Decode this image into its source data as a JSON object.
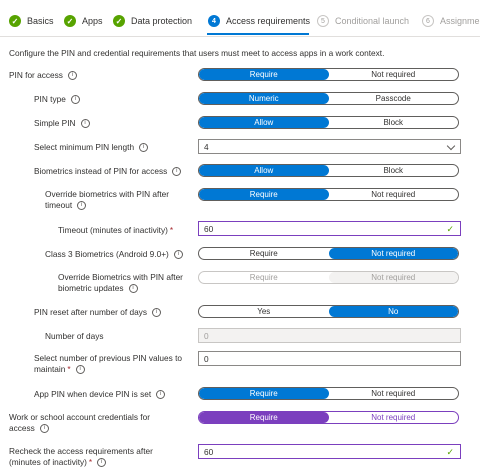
{
  "tabs": [
    {
      "label": "Basics",
      "state": "done",
      "icon": "check"
    },
    {
      "label": "Apps",
      "state": "done",
      "icon": "check"
    },
    {
      "label": "Data protection",
      "state": "done",
      "icon": "check"
    },
    {
      "label": "Access requirements",
      "state": "current",
      "num": "4"
    },
    {
      "label": "Conditional launch",
      "state": "todo",
      "num": "5"
    },
    {
      "label": "Assignments",
      "state": "todo",
      "num": "6"
    }
  ],
  "description": "Configure the PIN and credential requirements that users must meet to access apps in a work context.",
  "settings": {
    "pin_access": {
      "label": "PIN for access",
      "options": [
        "Require",
        "Not required"
      ],
      "selected": 0
    },
    "pin_type": {
      "label": "PIN type",
      "options": [
        "Numeric",
        "Passcode"
      ],
      "selected": 0
    },
    "simple_pin": {
      "label": "Simple PIN",
      "options": [
        "Allow",
        "Block"
      ],
      "selected": 0
    },
    "min_pin_length": {
      "label": "Select minimum PIN length",
      "value": "4"
    },
    "biometrics": {
      "label": "Biometrics instead of PIN for access",
      "options": [
        "Allow",
        "Block"
      ],
      "selected": 0
    },
    "override_biometrics": {
      "label_line1": "Override biometrics with PIN after",
      "label_line2": "timeout",
      "options": [
        "Require",
        "Not required"
      ],
      "selected": 0
    },
    "timeout": {
      "label": "Timeout (minutes of inactivity)",
      "value": "60"
    },
    "class3": {
      "label": "Class 3 Biometrics (Android 9.0+)",
      "options": [
        "Require",
        "Not required"
      ],
      "selected": 1
    },
    "override_bio_updates": {
      "label_line1": "Override Biometrics with PIN after",
      "label_line2": "biometric updates",
      "options": [
        "Require",
        "Not required"
      ],
      "selected": 1
    },
    "pin_reset": {
      "label": "PIN reset after number of days",
      "options": [
        "Yes",
        "No"
      ],
      "selected": 1
    },
    "number_of_days": {
      "label": "Number of days",
      "value": "0"
    },
    "previous_pins": {
      "label_line1": "Select number of previous PIN values to",
      "label_line2": "maintain",
      "value": "0"
    },
    "app_pin_device": {
      "label": "App PIN when device PIN is set",
      "options": [
        "Require",
        "Not required"
      ],
      "selected": 0
    },
    "work_credentials": {
      "label_line1": "Work or school account credentials for",
      "label_line2": "access",
      "options": [
        "Require",
        "Not required"
      ],
      "selected": 0
    },
    "recheck": {
      "label_line1": "Recheck the access requirements after",
      "label_line2": "(minutes of inactivity)",
      "value": "60"
    }
  },
  "colors": {
    "accent": "#0078d4",
    "success": "#57a300",
    "purple": "#7b3fbe",
    "required": "#a4262c"
  }
}
